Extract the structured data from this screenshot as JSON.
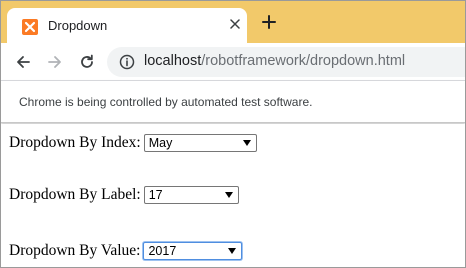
{
  "browser": {
    "tab_title": "Dropdown",
    "url_host": "localhost",
    "url_path": "/robotframework/dropdown.html",
    "infobar_text": "Chrome is being controlled by automated test software.",
    "tabstrip_color": "#f2c96a",
    "icons": {
      "favicon": "xampp-icon",
      "tab_close": "close-icon",
      "new_tab": "plus-icon",
      "back": "back-arrow-icon",
      "forward": "forward-arrow-icon",
      "reload": "reload-icon",
      "site_info": "info-icon"
    }
  },
  "page": {
    "dropdowns": [
      {
        "label": "Dropdown By Index:",
        "value": "May"
      },
      {
        "label": "Dropdown By Label:",
        "value": "17"
      },
      {
        "label": "Dropdown By Value:",
        "value": "2017"
      }
    ]
  }
}
